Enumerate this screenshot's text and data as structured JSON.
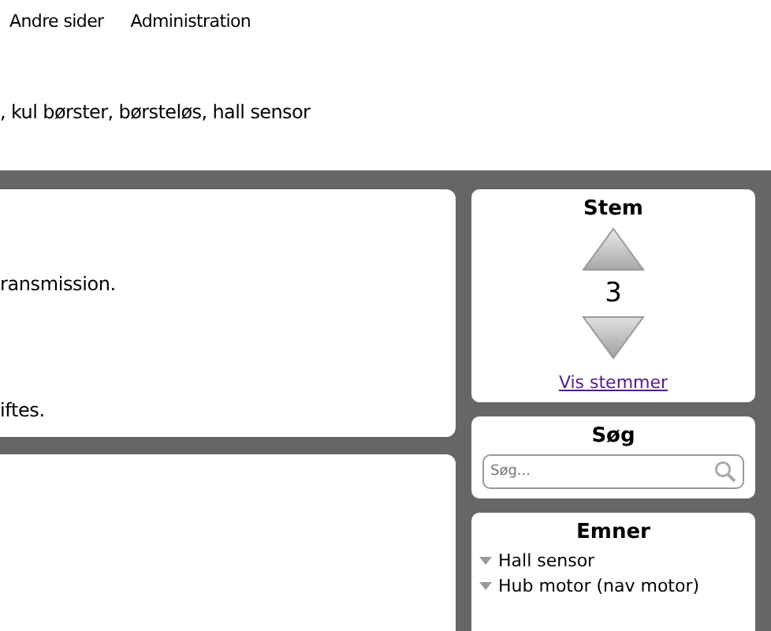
{
  "nav": [
    "Andre sider",
    "Administration"
  ],
  "keywords": ", kul børster, børsteløs, hall sensor",
  "article": {
    "lines": [
      "ransmission.",
      "iftes."
    ]
  },
  "vote": {
    "title": "Stem",
    "count": "3",
    "link": "Vis stemmer"
  },
  "search": {
    "title": "Søg",
    "placeholder": "Søg..."
  },
  "topics": {
    "title": "Emner",
    "items": [
      "Hall sensor",
      "Hub motor (nav motor)"
    ]
  }
}
